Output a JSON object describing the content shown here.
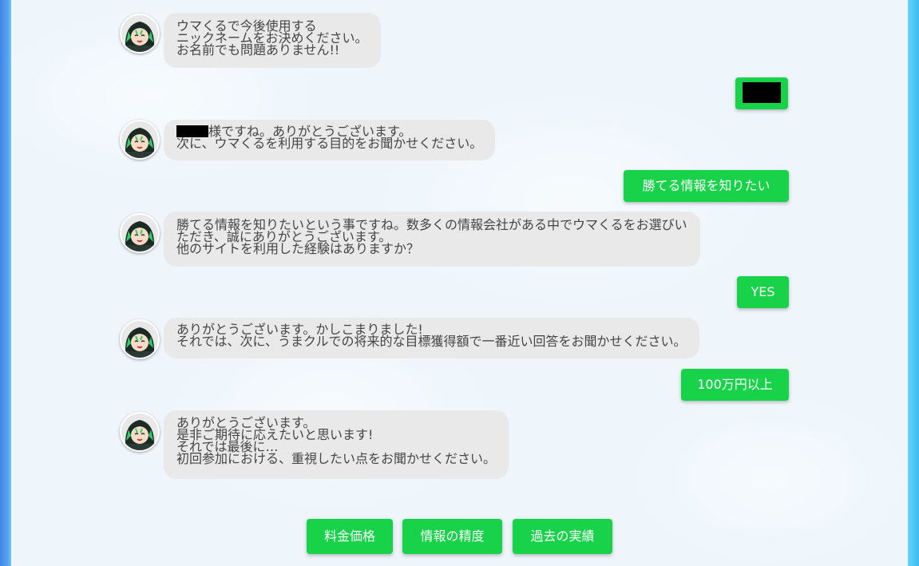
{
  "chat": {
    "messages": [
      {
        "from": "bot",
        "lines": [
          "ウマくるで今後使用する",
          "ニックネームをお決めください。",
          "お名前でも問題ありません!!"
        ]
      },
      {
        "from": "user",
        "answer": "",
        "redacted": true
      },
      {
        "from": "bot",
        "lines": [
          "様ですね。ありがとうございます。",
          "次に、ウマくるを利用する目的をお聞かせください。"
        ],
        "redacted_name": true
      },
      {
        "from": "user",
        "answer": "勝てる情報を知りたい"
      },
      {
        "from": "bot",
        "lines": [
          "勝てる情報を知りたいという事ですね。数多くの情報会社がある中でウマくるをお選びい",
          "ただき、誠にありがとうございます。",
          "他のサイトを利用した経験はありますか？"
        ]
      },
      {
        "from": "user",
        "answer": "YES"
      },
      {
        "from": "bot",
        "lines": [
          "ありがとうございます。かしこまりました!",
          "それでは、次に、うまクルでの将来的な目標獲得額で一番近い回答をお聞かせください。"
        ]
      },
      {
        "from": "user",
        "answer": "100万円以上"
      },
      {
        "from": "bot",
        "lines": [
          "ありがとうございます。",
          "是非ご期待に応えたいと思います!",
          "それでは最後に…",
          "初回参加における、重視したい点をお聞かせください。"
        ]
      }
    ],
    "choices": [
      "料金価格",
      "情報の精度",
      "過去の実績"
    ]
  },
  "colors": {
    "accent_green": "#18d34a",
    "bot_bubble": "#e9e9ea",
    "bot_text": "#444444",
    "page_bg": "#eef6fc"
  },
  "icons": {
    "bot_avatar": "character-avatar-icon"
  }
}
